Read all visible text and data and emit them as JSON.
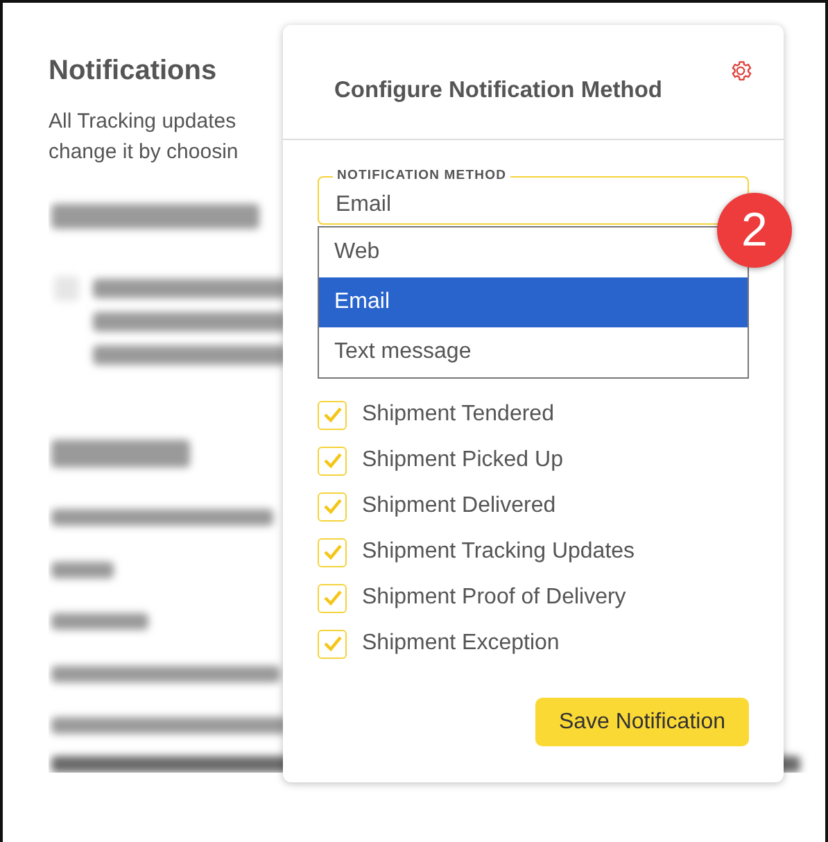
{
  "page": {
    "title": "Notifications",
    "intro_lines": [
      "All Tracking updates",
      "change it by choosin"
    ]
  },
  "dialog": {
    "title": "Configure Notification Method",
    "field": {
      "label": "NOTIFICATION METHOD",
      "value": "Email"
    },
    "options": [
      {
        "label": "Web",
        "selected": false
      },
      {
        "label": "Email",
        "selected": true
      },
      {
        "label": "Text message",
        "selected": false
      }
    ],
    "events": [
      {
        "label": "Shipment Tendered",
        "checked": true
      },
      {
        "label": "Shipment Picked Up",
        "checked": true
      },
      {
        "label": "Shipment Delivered",
        "checked": true
      },
      {
        "label": "Shipment Tracking Updates",
        "checked": true
      },
      {
        "label": "Shipment Proof of Delivery",
        "checked": true
      },
      {
        "label": "Shipment Exception",
        "checked": true
      }
    ],
    "save_button": "Save Notification"
  },
  "step_badge": "2"
}
